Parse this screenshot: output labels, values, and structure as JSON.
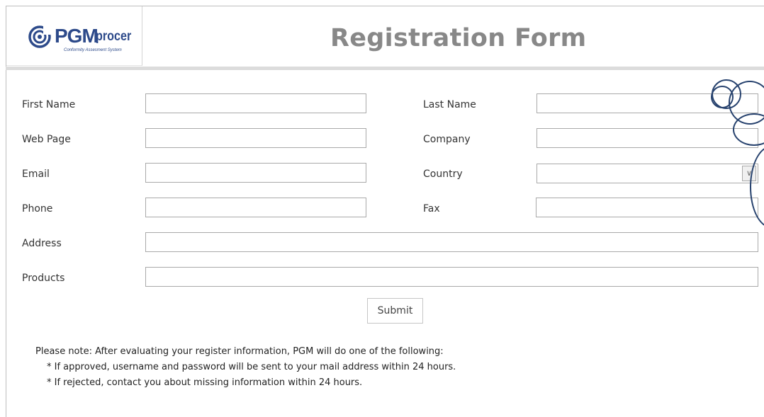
{
  "header": {
    "logo": {
      "brand": "PGM",
      "product": "procer",
      "tagline": "Conformity Assesment System"
    },
    "title": "Registration Form"
  },
  "form": {
    "first_name": {
      "label": "First Name",
      "value": ""
    },
    "last_name": {
      "label": "Last Name",
      "value": ""
    },
    "web_page": {
      "label": "Web Page",
      "value": ""
    },
    "company": {
      "label": "Company",
      "value": ""
    },
    "email": {
      "label": "Email",
      "value": ""
    },
    "country": {
      "label": "Country",
      "value": ""
    },
    "phone": {
      "label": "Phone",
      "value": ""
    },
    "fax": {
      "label": "Fax",
      "value": ""
    },
    "address": {
      "label": "Address",
      "value": ""
    },
    "products": {
      "label": "Products",
      "value": ""
    },
    "submit_label": "Submit"
  },
  "notes": {
    "intro": "Please note: After evaluating your register information, PGM will do one of the following:",
    "approved": "* If approved, username and password will be sent to your mail address within 24 hours.",
    "rejected": "* If rejected, contact you about missing information within 24 hours."
  },
  "colors": {
    "brand": "#2d4a8a",
    "title": "#888888",
    "header_rule": "#dcdcdc",
    "bubbles": "#27426e"
  },
  "icons": {
    "logo_mark": "swirl-icon",
    "country_dropdown": "chevron-down-icon"
  }
}
